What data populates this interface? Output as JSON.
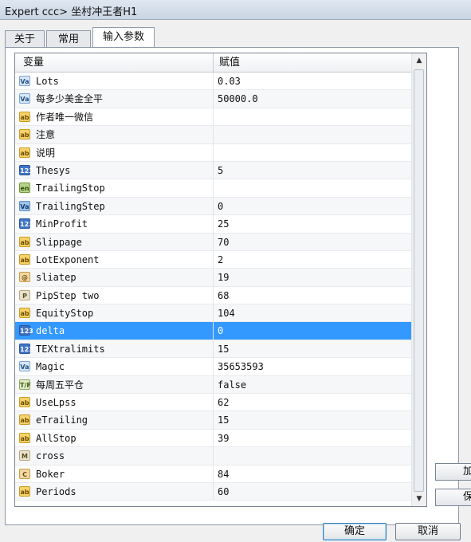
{
  "window": {
    "title": "Expert ccc> 坐村冲王者H1"
  },
  "tabs": [
    {
      "label": "关于",
      "active": false
    },
    {
      "label": "常用",
      "active": false
    },
    {
      "label": "输入参数",
      "active": true
    }
  ],
  "grid": {
    "header": {
      "variable": "变量",
      "value": "赋值"
    },
    "rows": [
      {
        "icon": "dbl",
        "glyph": "Va",
        "name": "Lots",
        "value": "0.03"
      },
      {
        "icon": "dbl",
        "glyph": "Va",
        "name": "每多少美金全平",
        "value": "50000.0"
      },
      {
        "icon": "ab",
        "glyph": "ab",
        "name": "作者唯一微信",
        "value": ""
      },
      {
        "icon": "ab",
        "glyph": "ab",
        "name": "注意",
        "value": ""
      },
      {
        "icon": "ab",
        "glyph": "ab",
        "name": "说明",
        "value": ""
      },
      {
        "icon": "num",
        "glyph": "123",
        "name": "Thesys",
        "value": "5"
      },
      {
        "icon": "enum",
        "glyph": "en",
        "name": "TrailingStop",
        "value": ""
      },
      {
        "icon": "val",
        "glyph": "Va",
        "name": "TrailingStep",
        "value": "0"
      },
      {
        "icon": "num",
        "glyph": "123",
        "name": "MinProfit",
        "value": "25"
      },
      {
        "icon": "ab",
        "glyph": "ab",
        "name": "Slippage",
        "value": "70"
      },
      {
        "icon": "ab",
        "glyph": "ab",
        "name": "LotExponent",
        "value": "2"
      },
      {
        "icon": "clr",
        "glyph": "@",
        "name": "sliatep",
        "value": "19"
      },
      {
        "icon": "tf",
        "glyph": "P",
        "name": "PipStep two",
        "value": "68"
      },
      {
        "icon": "ab",
        "glyph": "ab",
        "name": "EquityStop",
        "value": "104"
      },
      {
        "icon": "num",
        "glyph": "123",
        "name": "delta",
        "value": "0",
        "selected": true
      },
      {
        "icon": "num",
        "glyph": "123",
        "name": "TEXtralimits",
        "value": "15"
      },
      {
        "icon": "dbl",
        "glyph": "Va",
        "name": "Magic",
        "value": "35653593"
      },
      {
        "icon": "bool",
        "glyph": "T/F",
        "name": "每周五平仓",
        "value": "false"
      },
      {
        "icon": "ab",
        "glyph": "ab",
        "name": "UseLpss",
        "value": "62"
      },
      {
        "icon": "ab",
        "glyph": "ab",
        "name": "eTrailing",
        "value": "15"
      },
      {
        "icon": "ab",
        "glyph": "ab",
        "name": "AllStop",
        "value": "39"
      },
      {
        "icon": "tf",
        "glyph": "M",
        "name": "cross",
        "value": ""
      },
      {
        "icon": "clr",
        "glyph": "C",
        "name": "Boker",
        "value": "84"
      },
      {
        "icon": "ab",
        "glyph": "ab",
        "name": "Periods",
        "value": "60"
      }
    ]
  },
  "side_buttons": {
    "load": "加",
    "save": "保"
  },
  "buttons": {
    "ok": "确定",
    "cancel": "取消"
  }
}
